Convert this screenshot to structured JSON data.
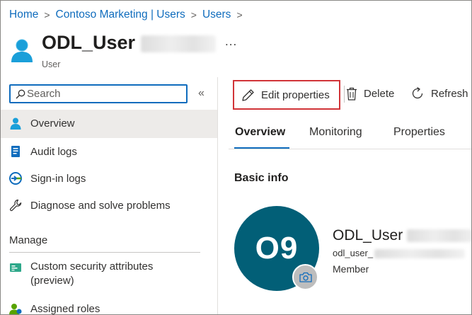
{
  "breadcrumb": {
    "items": [
      "Home",
      "Contoso Marketing | Users",
      "Users"
    ],
    "separator": ">"
  },
  "header": {
    "title": "ODL_User",
    "subtitle": "User",
    "more_label": "..."
  },
  "sidebar": {
    "search_placeholder": "Search",
    "collapse_glyph": "«",
    "items": [
      {
        "label": "Overview",
        "icon": "user-icon",
        "active": true
      },
      {
        "label": "Audit logs",
        "icon": "audit-log-icon"
      },
      {
        "label": "Sign-in logs",
        "icon": "sign-in-icon"
      },
      {
        "label": "Diagnose and solve problems",
        "icon": "wrench-icon"
      }
    ],
    "section_title": "Manage",
    "manage_items": [
      {
        "label": "Custom security attributes",
        "label_line2": "(preview)",
        "icon": "security-attributes-icon"
      },
      {
        "label": "Assigned roles",
        "icon": "roles-icon"
      }
    ]
  },
  "toolbar": {
    "edit_label": "Edit properties",
    "delete_label": "Delete",
    "refresh_label": "Refresh"
  },
  "tabs": [
    {
      "label": "Overview",
      "active": true
    },
    {
      "label": "Monitoring"
    },
    {
      "label": "Properties"
    }
  ],
  "basic_info": {
    "heading": "Basic info",
    "avatar_initials": "O9",
    "name": "ODL_User",
    "email": "odl_user_",
    "user_type": "Member"
  },
  "colors": {
    "accent": "#0f6cbd",
    "avatar": "#025f77",
    "highlight": "#d13438"
  }
}
